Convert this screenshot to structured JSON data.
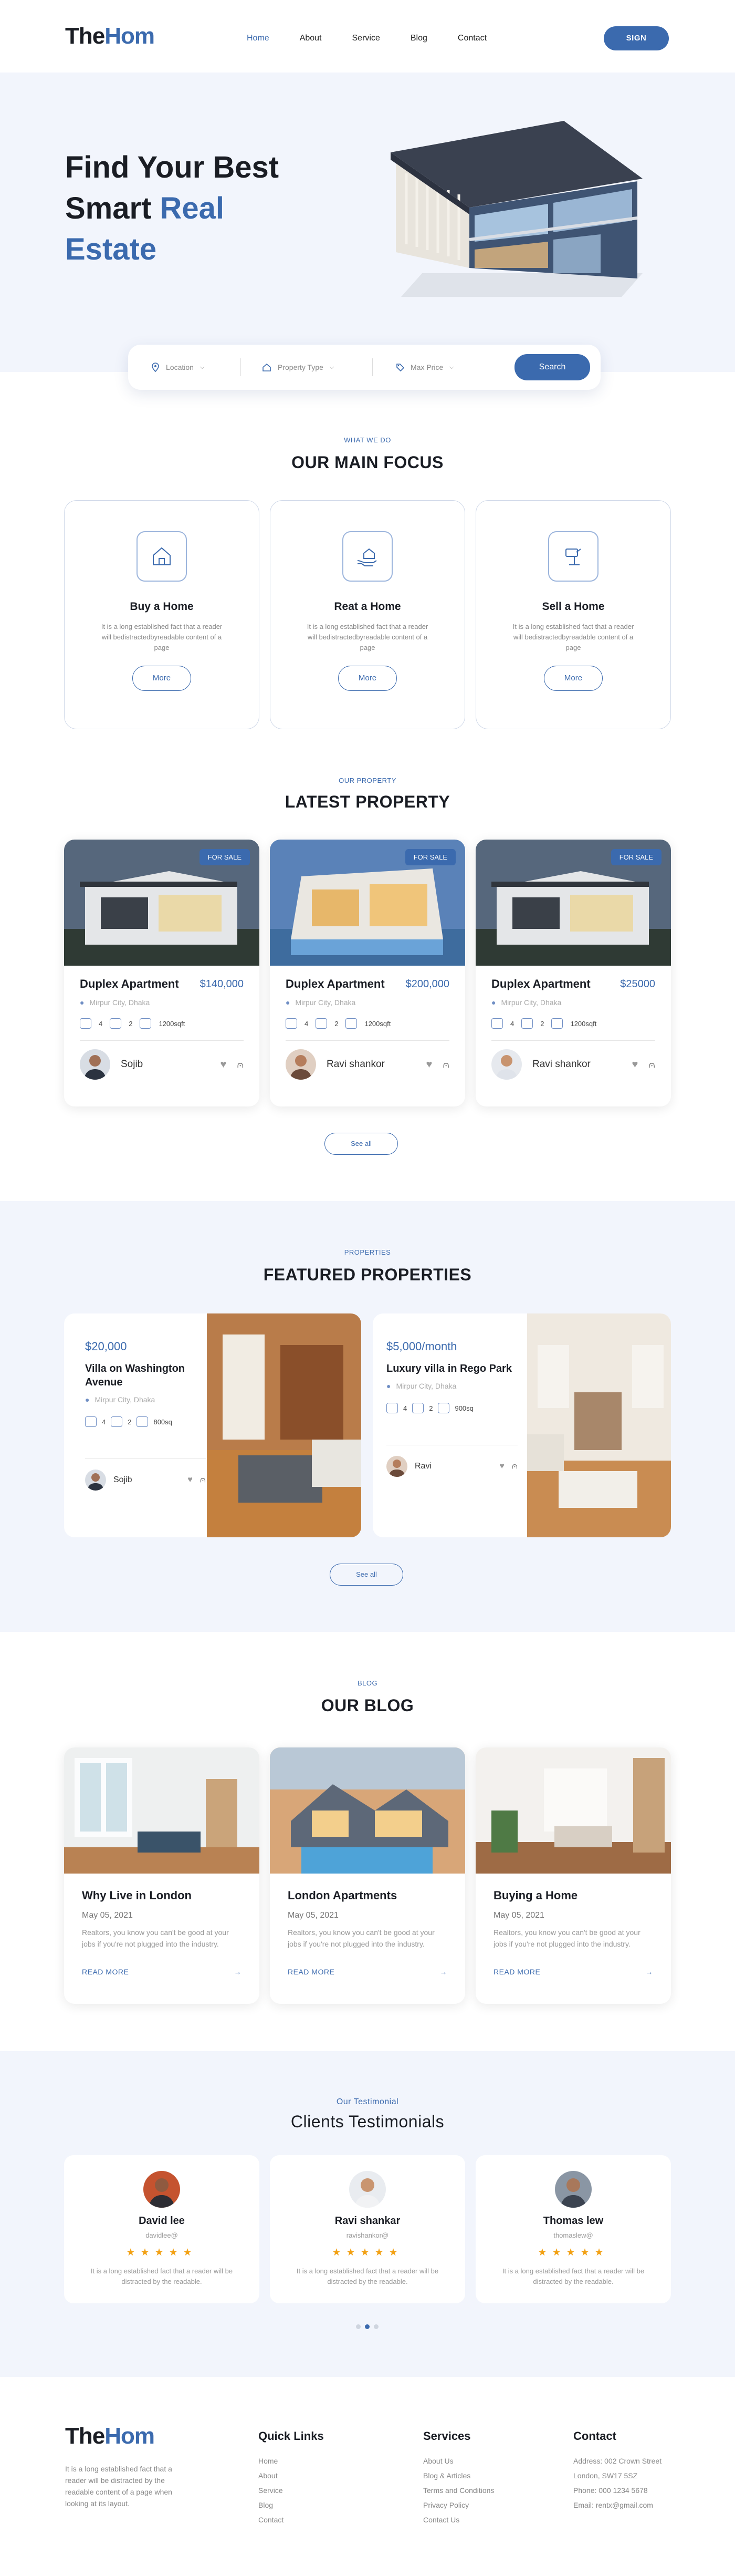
{
  "header": {
    "logo_a": "The",
    "logo_b": "Hom",
    "nav": [
      "Home",
      "About",
      "Service",
      "Blog",
      "Contact"
    ],
    "signin": "SIGN"
  },
  "hero": {
    "line1": "Find Your Best",
    "line2a": "Smart ",
    "line2b": "Real",
    "line3": "Estate"
  },
  "search": {
    "location": "Location",
    "type": "Property Type",
    "price": "Max Price",
    "button": "Search"
  },
  "focus": {
    "eyebrow": "WHAT WE DO",
    "title": "OUR MAIN FOCUS",
    "cards": [
      {
        "title": "Buy a Home",
        "desc": "It is a long established fact that a reader will bedistractedbyreadable content of a page",
        "button": "More"
      },
      {
        "title": "Reat a Home",
        "desc": "It is a long established fact that a reader will bedistractedbyreadable content of a page",
        "button": "More"
      },
      {
        "title": "Sell a Home",
        "desc": "It is a long established fact that a reader will bedistractedbyreadable content of a page",
        "button": "More"
      }
    ]
  },
  "latest": {
    "eyebrow": "OUR PROPERTY",
    "title": "LATEST PROPERTY",
    "tag": "FOR SALE",
    "see_all": "See all",
    "cards": [
      {
        "name": "Duplex Apartment",
        "price": "$140,000",
        "location": "Mirpur City, Dhaka",
        "beds": "4",
        "baths": "2",
        "area": "1200sqft",
        "owner": "Sojib"
      },
      {
        "name": "Duplex Apartment",
        "price": "$200,000",
        "location": "Mirpur City, Dhaka",
        "beds": "4",
        "baths": "2",
        "area": "1200sqft",
        "owner": "Ravi shankor"
      },
      {
        "name": "Duplex Apartment",
        "price": "$25000",
        "location": "Mirpur City, Dhaka",
        "beds": "4",
        "baths": "2",
        "area": "1200sqft",
        "owner": "Ravi shankor"
      }
    ]
  },
  "featured": {
    "eyebrow": "PROPERTIES",
    "title": "FEATURED PROPERTIES",
    "see_all": "See all",
    "cards": [
      {
        "price": "$20,000",
        "name": "Villa on Washington Avenue",
        "location": "Mirpur City, Dhaka",
        "beds": "4",
        "baths": "2",
        "area": "800sq",
        "owner": "Sojib"
      },
      {
        "price": "$5,000/month",
        "name": "Luxury villa in Rego Park",
        "location": "Mirpur City, Dhaka",
        "beds": "4",
        "baths": "2",
        "area": "900sq",
        "owner": "Ravi"
      }
    ]
  },
  "blog": {
    "eyebrow": "BLOG",
    "title": "OUR BLOG",
    "cards": [
      {
        "title": "Why Live in London",
        "date": "May 05, 2021",
        "desc": "Realtors, you know you can't be good at your jobs if you're not plugged into the industry.",
        "read": "READ MORE"
      },
      {
        "title": "London Apartments",
        "date": "May 05, 2021",
        "desc": "Realtors, you know you can't be good at your jobs if you're not plugged into the industry.",
        "read": "READ MORE"
      },
      {
        "title": "Buying a Home",
        "date": "May 05, 2021",
        "desc": "Realtors, you know you can't be good at your jobs if you're not plugged into the industry.",
        "read": "READ MORE"
      }
    ]
  },
  "testimonials": {
    "eyebrow": "Our Testimonial",
    "title": "Clients Testimonials",
    "cards": [
      {
        "name": "David lee",
        "handle": "davidlee@",
        "text": "It is a long established fact that a reader will be distracted by the readable.",
        "rating": 5
      },
      {
        "name": "Ravi shankar",
        "handle": "ravishankor@",
        "text": "It is a long established fact that a reader will be distracted by the readable.",
        "rating": 5
      },
      {
        "name": "Thomas lew",
        "handle": "thomaslew@",
        "text": "It is a long established fact that a reader will be distracted by the readable.",
        "rating": 5
      }
    ]
  },
  "footer": {
    "logo_a": "The",
    "logo_b": "Hom",
    "desc": "It is a long established fact that a reader will be distracted by the readable content of a page when looking at its layout.",
    "quick_title": "Quick Links",
    "quick": [
      "Home",
      "About",
      "Service",
      "Blog",
      "Contact"
    ],
    "services_title": "Services",
    "services": [
      "About Us",
      "Blog & Articles",
      "Terms and Conditions",
      "Privacy Policy",
      "Contact Us"
    ],
    "contact_title": "Contact",
    "contact": [
      "Address: 002 Crown Street",
      "London, SW17 5SZ",
      "Phone: 000 1234 5678",
      "Email: rentx@gmail.com"
    ]
  },
  "colors": {
    "accent": "#3b6aae",
    "star": "#f2a114",
    "tint": "#f2f5fc"
  }
}
